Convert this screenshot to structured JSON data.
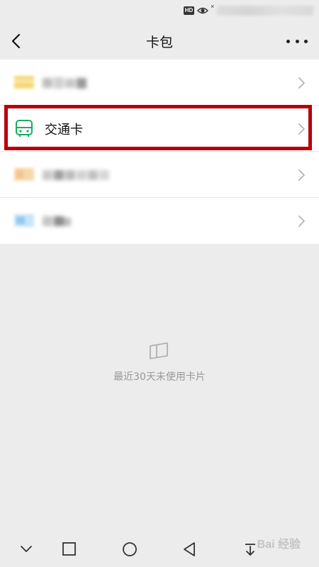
{
  "status_bar": {
    "hd_badge": "HD",
    "x_marker": "×"
  },
  "header": {
    "title": "卡包"
  },
  "cards": [
    {
      "label": "",
      "blurred": true,
      "icon": "yellow-card-icon",
      "color": "#f5d774"
    },
    {
      "label": "交通卡",
      "blurred": false,
      "icon": "bus-icon",
      "color": "#1aad5e"
    },
    {
      "label": "",
      "blurred": true,
      "icon": "orange-card-icon",
      "color": "#f3c58a"
    },
    {
      "label": "",
      "blurred": true,
      "icon": "blue-card-icon",
      "color": "#8cc8ef"
    }
  ],
  "empty_state": {
    "text": "最近30天未使用卡片"
  },
  "watermark": {
    "text": "Bai 经验"
  },
  "colors": {
    "highlight": "#b8000a",
    "background": "#ececec",
    "accent_green": "#1aad5e"
  }
}
